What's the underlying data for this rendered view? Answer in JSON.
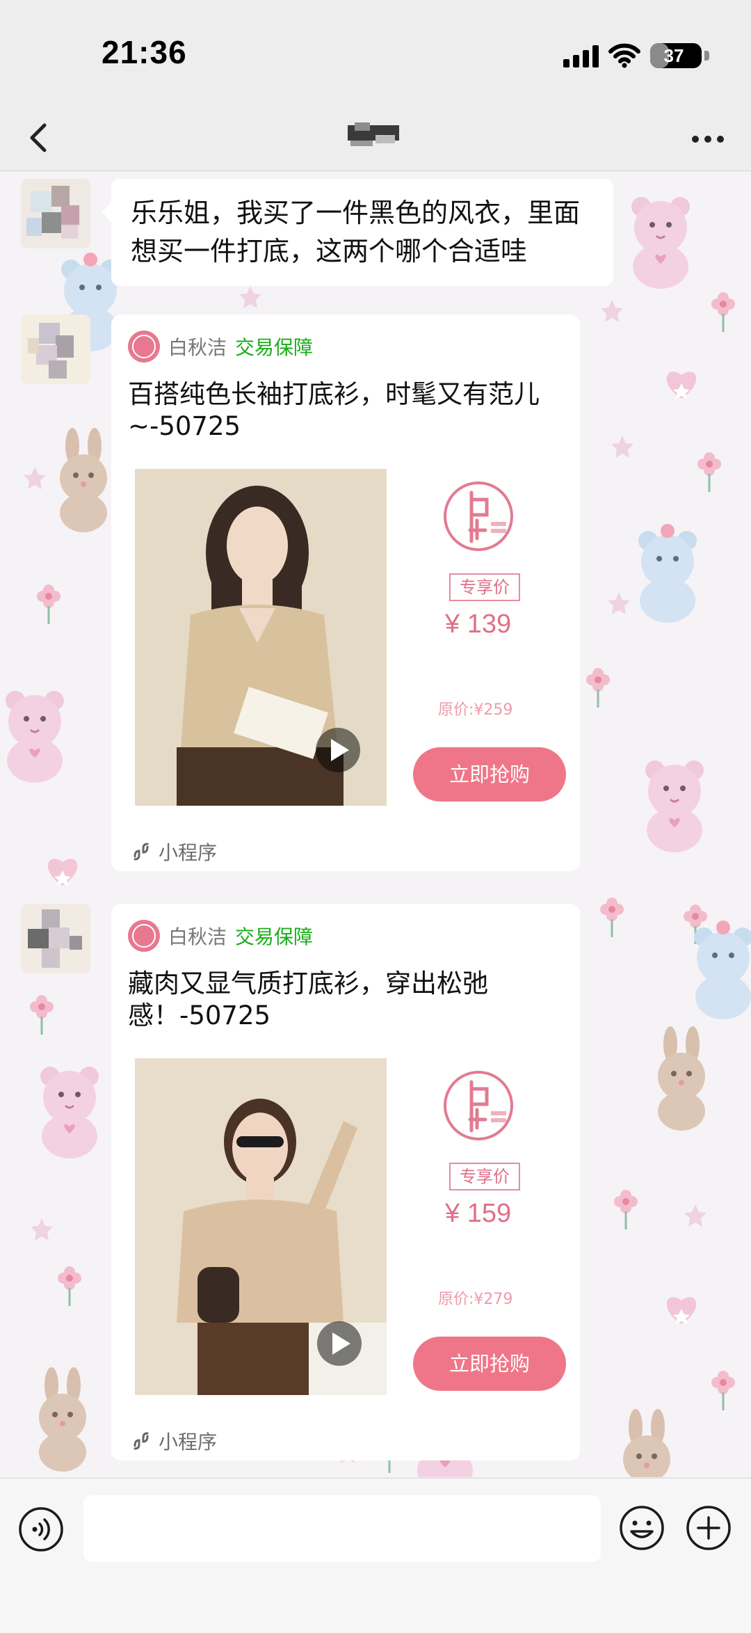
{
  "status_bar": {
    "time": "21:36",
    "battery": "37",
    "battery_level": 0.37,
    "icons": [
      "signal-icon",
      "wifi-icon",
      "battery-icon"
    ]
  },
  "navbar": {
    "title": "",
    "icons": [
      "back-icon",
      "more-icon"
    ]
  },
  "messages": [
    {
      "type": "text",
      "text": "乐乐姐，我买了一件黑色的风衣，里面想买一件打底，这两个哪个合适哇"
    },
    {
      "type": "product-card",
      "shop_name": "白秋洁",
      "guarantee": "交易保障",
      "title": "百搭纯色长袖打底衫，时髦又有范儿~-50725",
      "badge": "专享价",
      "price": "¥ 139",
      "original_price": "原价:¥259",
      "buy_label": "立即抢购",
      "source_label": "小程序"
    },
    {
      "type": "product-card",
      "shop_name": "白秋洁",
      "guarantee": "交易保障",
      "title": "藏肉又显气质打底衫，穿出松弛感！-50725",
      "badge": "专享价",
      "price": "¥ 159",
      "original_price": "原价:¥279",
      "buy_label": "立即抢购",
      "source_label": "小程序"
    }
  ],
  "input_bar": {
    "icons": [
      "voice-icon",
      "emoji-icon",
      "plus-icon"
    ]
  },
  "colors": {
    "accent_pink": "#ef7688",
    "guarantee_green": "#1aad19",
    "chat_background": "#f6f3f6",
    "bar_background": "#ededed"
  }
}
